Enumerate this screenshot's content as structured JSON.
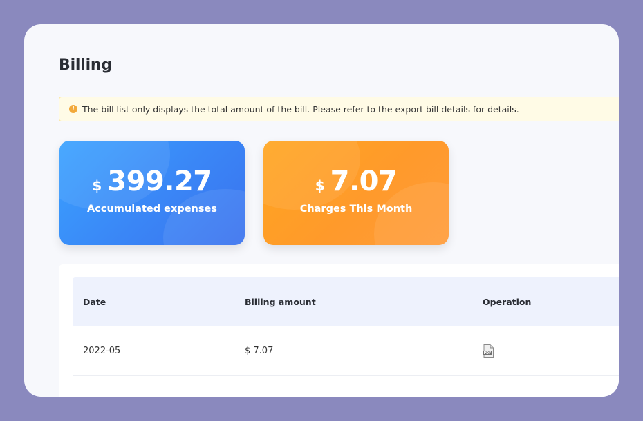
{
  "page": {
    "title": "Billing"
  },
  "notice": {
    "icon": "warning-icon",
    "text": "The bill list only displays the total amount of the bill. Please refer to the export bill details for details."
  },
  "cards": [
    {
      "currency": "$",
      "value": "399.27",
      "label": "Accumulated expenses",
      "color": "#3a8cf8"
    },
    {
      "currency": "$",
      "value": "7.07",
      "label": "Charges This Month",
      "color": "#ffa026"
    }
  ],
  "table": {
    "headers": [
      "Date",
      "Billing amount",
      "Operation"
    ],
    "rows": [
      {
        "date": "2022-05",
        "amount": "$ 7.07",
        "operation_icon": "pdf-icon"
      }
    ]
  }
}
